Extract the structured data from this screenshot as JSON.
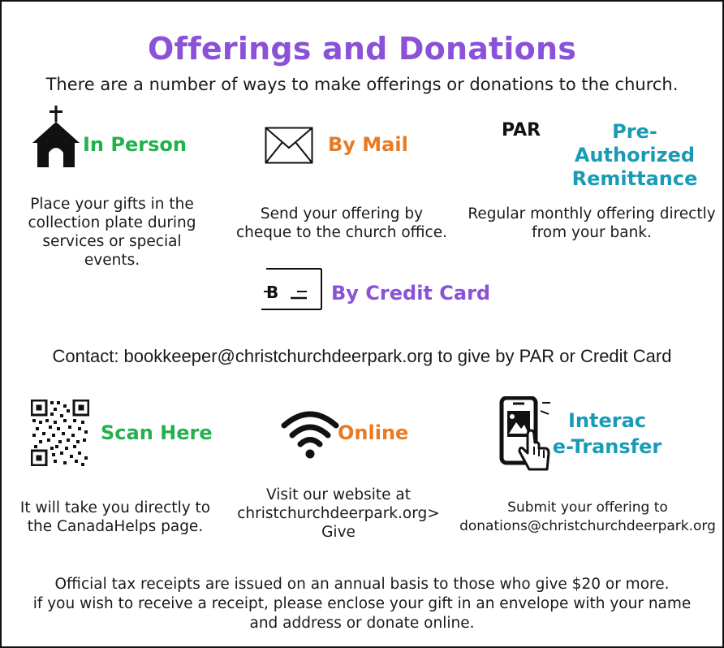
{
  "title": "Offerings and Donations",
  "subtitle": "There are a number of ways to make offerings or donations to the church.",
  "colors": {
    "purple": "#8a52d8",
    "green": "#22b14c",
    "orange": "#ea7a22",
    "teal": "#1a9bb5"
  },
  "methods": {
    "in_person": {
      "heading": "In Person",
      "icon": "church-icon",
      "desc": [
        "Place your gifts in the",
        "collection plate during",
        "services or special events."
      ]
    },
    "by_mail": {
      "heading": "By Mail",
      "icon": "envelope-icon",
      "desc": [
        "Send your offering by",
        "cheque to the church office."
      ]
    },
    "par": {
      "prefix": "PAR",
      "heading": [
        "Pre-Authorized",
        "Remittance"
      ],
      "desc": [
        "Regular monthly offering directly",
        "from your bank."
      ]
    },
    "credit_card": {
      "heading": "By Credit Card",
      "icon": "credit-card-icon"
    },
    "scan": {
      "heading": "Scan Here",
      "icon": "qr-code-icon",
      "desc": [
        "It will take you directly to",
        "the CanadaHelps page."
      ]
    },
    "online": {
      "heading": "Online",
      "icon": "wifi-icon",
      "desc": [
        "Visit our website at",
        "christchurchdeerpark.org>",
        "Give"
      ]
    },
    "interac": {
      "heading": [
        "Interac",
        "e-Transfer"
      ],
      "icon": "phone-tap-icon",
      "desc": [
        "Submit your offering to",
        "donations@christchurchdeerpark.org"
      ]
    }
  },
  "contact": "Contact: bookkeeper@christchurchdeerpark.org to give by PAR or Credit Card",
  "footer": [
    "Official tax receipts are issued on an annual basis to those who give $20 or more.",
    "if you wish to receive a receipt, please enclose your gift in an envelope with your name",
    "and address or donate online."
  ]
}
